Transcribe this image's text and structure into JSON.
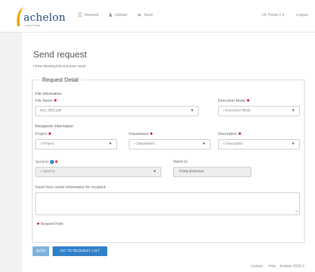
{
  "brand": {
    "name": "achelon",
    "tagline": "a futurit Pulsar"
  },
  "nav": {
    "request": "Request",
    "upload": "Upload",
    "send": "Send",
    "user": "Hi, Portal 1 ▾",
    "logout": "Logout"
  },
  "page": {
    "title": "Send request",
    "subtitle": "Fill the following field and press 'Send'"
  },
  "form": {
    "legend": "Request Detail",
    "file_section": "File Information",
    "file_name_label": "File Name",
    "file_name_value": "test_0001.pdf",
    "execution_mode_label": "Execution Mode",
    "execution_mode_value": "» Execution Mode",
    "recipients_section": "Recipients Information",
    "project_label": "Project",
    "project_value": "» Project",
    "department_label": "Department",
    "department_value": "» Department",
    "description_label": "Description",
    "description_value": "» Description",
    "send_to_label": "Send to",
    "send_to_value": "» Send to",
    "name_to_label": "Name to",
    "name_to_value": "Porta External",
    "comment_label": "Insert here useful information for recipient",
    "comment_value": "",
    "required_note": "Required Field",
    "required_mark": "✱",
    "info_mark": "i"
  },
  "buttons": {
    "send": "SEND",
    "go_to_list": "GO TO REQUEST LIST"
  },
  "footer": {
    "contact": "Contact",
    "help": "Help",
    "copyright": "Achelon 2018 ©"
  },
  "colors": {
    "brand_blue": "#2f7fc9",
    "logo_orange": "#f0a500",
    "required_red": "#d0021b"
  },
  "icons": {
    "request": "list-icon",
    "upload": "users-icon",
    "send": "send-icon"
  }
}
